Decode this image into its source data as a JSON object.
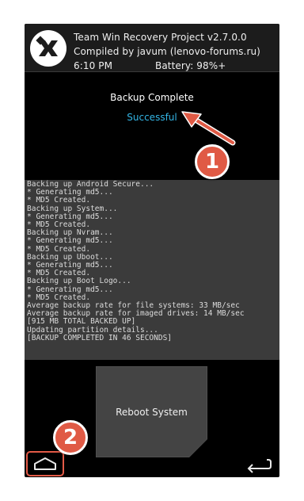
{
  "header": {
    "title": "Team Win Recovery Project  v2.7.0.0",
    "compiled": "Compiled by javum (lenovo-forums.ru)",
    "time": "6:10 PM",
    "battery": "Battery: 98%+"
  },
  "status": {
    "title": "Backup Complete",
    "result": "Successful"
  },
  "console": {
    "lines": [
      "Backing up Android Secure...",
      " * Generating md5...",
      " * MD5 Created.",
      "Backing up System...",
      " * Generating md5...",
      " * MD5 Created.",
      "Backing up Nvram...",
      " * Generating md5...",
      " * MD5 Created.",
      "Backing up Uboot...",
      " * Generating md5...",
      " * MD5 Created.",
      "Backing up Boot Logo...",
      " * Generating md5...",
      " * MD5 Created.",
      "Average backup rate for file systems: 33 MB/sec",
      "Average backup rate for imaged drives: 14 MB/sec",
      "[915 MB TOTAL BACKED UP]",
      "Updating partition details...",
      "[BACKUP COMPLETED IN 46 SECONDS]"
    ]
  },
  "buttons": {
    "reboot": "Reboot System"
  },
  "annotations": {
    "badge_1": "1",
    "badge_2": "2"
  },
  "colors": {
    "accent": "#33b5e5",
    "annotation": "#e05a45"
  }
}
